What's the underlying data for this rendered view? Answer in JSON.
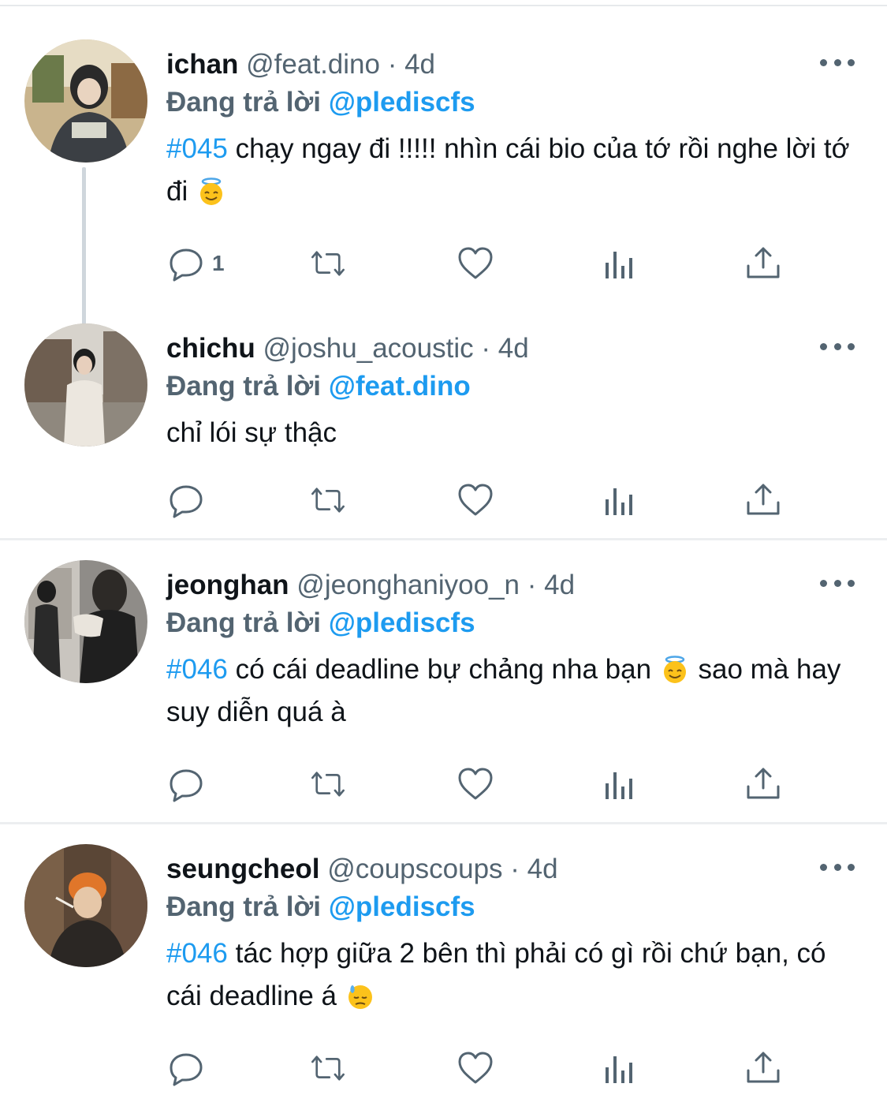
{
  "tweets": [
    {
      "name": "ichan",
      "handle": "@feat.dino",
      "separator": "·",
      "time": "4d",
      "reply_prefix": "Đang trả lời",
      "reply_to": "@plediscfs",
      "hashtag": "#045",
      "text": " chạy ngay đi !!!!! nhìn cái bio của tớ rồi nghe lời tớ đi ",
      "text_after": "",
      "emoji": "smiling-face-with-halo",
      "reply_count": "1"
    },
    {
      "name": "chichu",
      "handle": "@joshu_acoustic",
      "separator": "·",
      "time": "4d",
      "reply_prefix": "Đang trả lời",
      "reply_to": "@feat.dino",
      "hashtag": "",
      "text": "chỉ lói sự thậc",
      "text_after": "",
      "emoji": "",
      "reply_count": ""
    },
    {
      "name": "jeonghan",
      "handle": "@jeonghaniyoo_n",
      "separator": "·",
      "time": "4d",
      "reply_prefix": "Đang trả lời",
      "reply_to": "@plediscfs",
      "hashtag": "#046",
      "text": " có cái deadline bự chảng nha bạn ",
      "text_after": "  sao mà hay suy diễn quá à",
      "emoji": "smiling-face-with-halo",
      "reply_count": ""
    },
    {
      "name": "seungcheol",
      "handle": "@coupscoups",
      "separator": "·",
      "time": "4d",
      "reply_prefix": "Đang trả lời",
      "reply_to": "@plediscfs",
      "hashtag": "#046",
      "text": " tác hợp giữa 2 bên thì phải có gì rồi chứ bạn, có cái deadline á ",
      "text_after": "",
      "emoji": "downcast-face-with-sweat",
      "reply_count": ""
    }
  ],
  "colors": {
    "accent": "#1d9bf0",
    "secondary_text": "#536471",
    "primary_text": "#0f1419",
    "divider": "#eceef0",
    "thread_line": "#cfd6dc"
  },
  "icons": [
    "reply-icon",
    "retweet-icon",
    "like-icon",
    "views-icon",
    "share-icon",
    "more-icon"
  ]
}
